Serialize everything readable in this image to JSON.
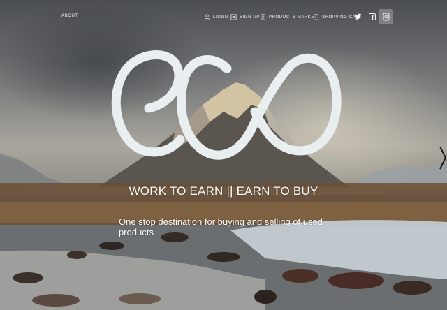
{
  "nav": {
    "about_label": "ABOUT",
    "items": [
      {
        "label": "LOGIN",
        "icon": "user-icon"
      },
      {
        "label": "SIGN UP",
        "icon": "signup-icon"
      },
      {
        "label": "PRODUCTS MARKET",
        "icon": "market-icon"
      },
      {
        "label": "SHOPPING CART",
        "icon": "cart-icon"
      }
    ],
    "social": [
      "twitter-icon",
      "facebook-icon",
      "instagram-icon"
    ]
  },
  "hero": {
    "logo_text": "eco",
    "tagline": "WORK TO EARN || EARN TO BUY",
    "subtitle": "One stop destination for buying and selling of used products"
  },
  "colors": {
    "logo_stroke": "#e9eef0",
    "text": "#ffffff"
  }
}
